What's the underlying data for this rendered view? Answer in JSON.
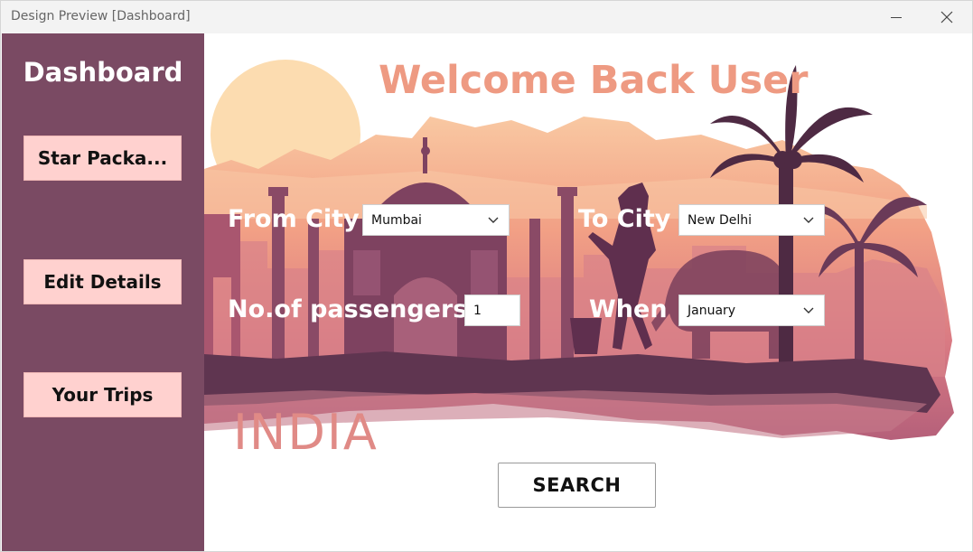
{
  "window": {
    "title": "Design Preview [Dashboard]",
    "minimize_glyph": "—",
    "close_glyph": "✕"
  },
  "sidebar": {
    "title": "Dashboard",
    "items": [
      {
        "label": "Star Packa..."
      },
      {
        "label": "Edit Details"
      },
      {
        "label": "Your Trips"
      }
    ]
  },
  "main": {
    "welcome": "Welcome Back User",
    "from_city": {
      "label": "From City",
      "value": "Mumbai"
    },
    "to_city": {
      "label": "To City",
      "value": "New Delhi"
    },
    "passengers": {
      "label": "No.of passengers",
      "value": "1"
    },
    "when": {
      "label": "When",
      "value": "January"
    },
    "search_label": "SEARCH",
    "banner_text": "INDIA"
  },
  "colors": {
    "sidebar": "#7a4a63",
    "sidebar_button": "#ffd1cf",
    "welcome_text": "#ee9a82",
    "sun": "#fcd9ae",
    "banner_text": "#e08a86"
  },
  "icons": {
    "dropdown": "chevron-down-icon",
    "minimize": "minimize-icon",
    "close": "close-icon"
  }
}
